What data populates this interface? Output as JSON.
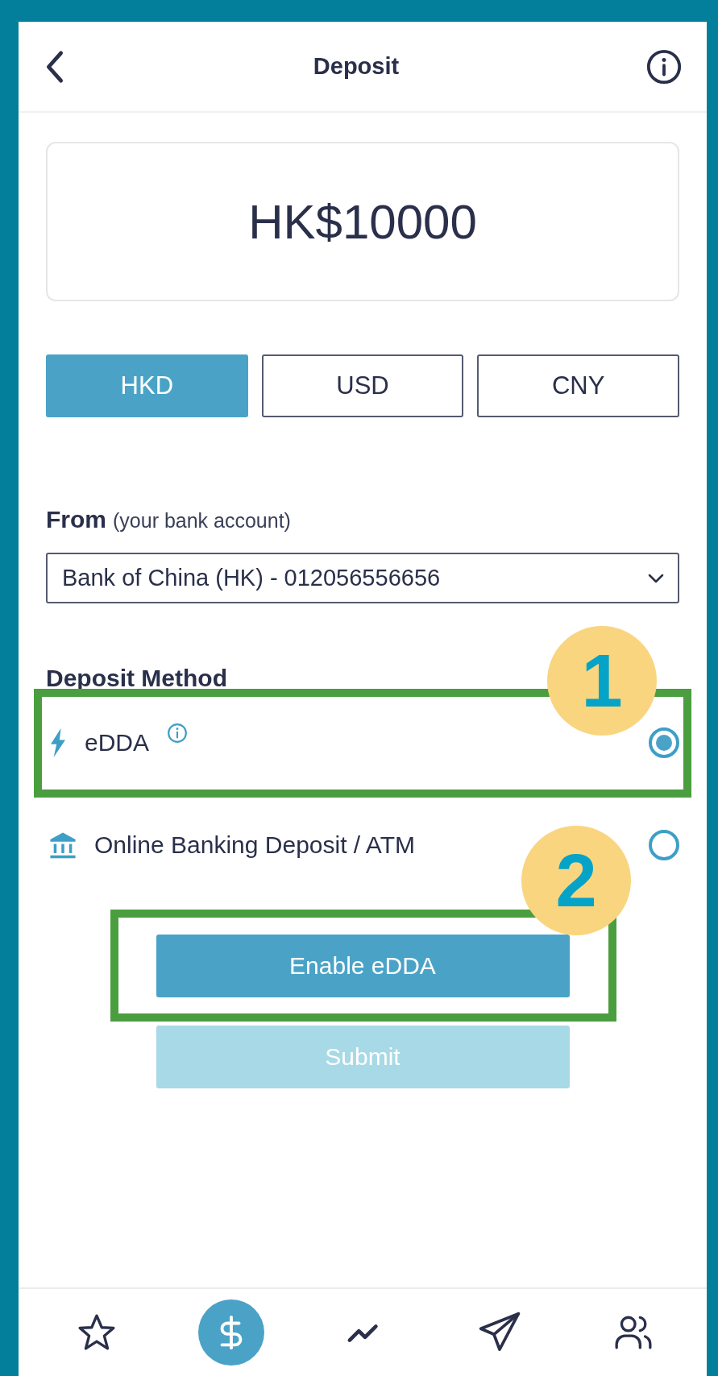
{
  "header": {
    "title": "Deposit"
  },
  "amount": "HK$10000",
  "currencies": [
    {
      "label": "HKD",
      "selected": true
    },
    {
      "label": "USD",
      "selected": false
    },
    {
      "label": "CNY",
      "selected": false
    }
  ],
  "from": {
    "label": "From",
    "hint": "(your bank account)",
    "value": "Bank of China (HK) - 012056556656"
  },
  "deposit_method": {
    "label": "Deposit Method",
    "options": [
      {
        "kind": "lightning",
        "label": "eDDA",
        "info": true,
        "selected": true
      },
      {
        "kind": "bank",
        "label": "Online Banking Deposit / ATM",
        "selected": false
      }
    ]
  },
  "buttons": [
    {
      "label": "Enable eDDA",
      "disabled": false
    },
    {
      "label": "Submit",
      "disabled": true
    }
  ],
  "nav": [
    {
      "selected": false
    },
    {
      "selected": true
    },
    {
      "selected": false
    },
    {
      "selected": false
    },
    {
      "selected": false
    }
  ],
  "annotations": [
    {
      "label": "1"
    },
    {
      "label": "2"
    }
  ]
}
